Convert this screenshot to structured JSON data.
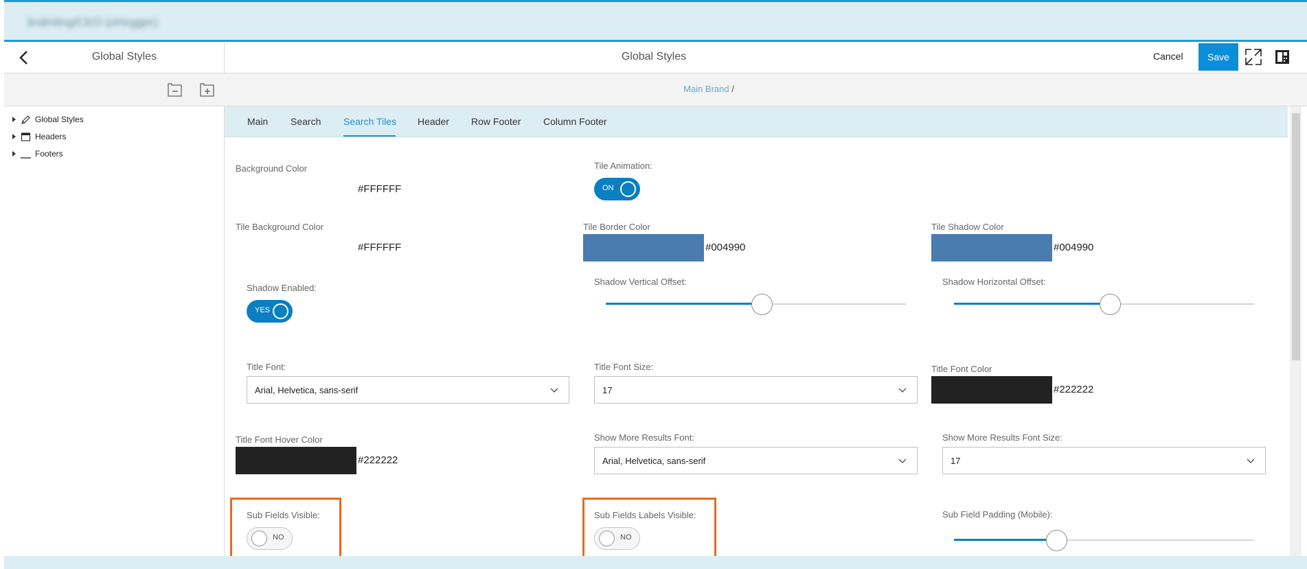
{
  "banner": {
    "title": "lindmling/CEO (oHogger)"
  },
  "left_panel": {
    "title": "Global Styles",
    "tree": [
      {
        "label": "Global Styles",
        "icon": "pencil-icon"
      },
      {
        "label": "Headers",
        "icon": "window-icon"
      },
      {
        "label": "Footers",
        "icon": "underline-icon"
      }
    ]
  },
  "header": {
    "title": "Global Styles",
    "cancel_label": "Cancel",
    "save_label": "Save"
  },
  "breadcrumb": {
    "link": "Main Brand",
    "separator": "/"
  },
  "tabs": [
    {
      "label": "Main",
      "active": false
    },
    {
      "label": "Search",
      "active": false
    },
    {
      "label": "Search Tiles",
      "active": true
    },
    {
      "label": "Header",
      "active": false
    },
    {
      "label": "Row Footer",
      "active": false
    },
    {
      "label": "Column Footer",
      "active": false
    }
  ],
  "form": {
    "background_color": {
      "label": "Background Color",
      "value": "#FFFFFF"
    },
    "tile_animation": {
      "label": "Tile Animation:",
      "state_text": "ON",
      "on": true
    },
    "tile_background_color": {
      "label": "Tile Background Color",
      "value": "#FFFFFF"
    },
    "tile_border_color": {
      "label": "Tile Border Color",
      "value": "#004990",
      "swatch": "#4a7cb0"
    },
    "tile_shadow_color": {
      "label": "Tile Shadow Color",
      "value": "#004990",
      "swatch": "#4a7cb0"
    },
    "shadow_enabled": {
      "label": "Shadow Enabled:",
      "state_text": "YES",
      "on": true
    },
    "shadow_vertical_offset": {
      "label": "Shadow Vertical Offset:",
      "fraction": 0.52
    },
    "shadow_horizontal_offset": {
      "label": "Shadow Horizontal Offset:",
      "fraction": 0.52
    },
    "title_font": {
      "label": "Title Font:",
      "value": "Arial, Helvetica, sans-serif"
    },
    "title_font_size": {
      "label": "Title Font Size:",
      "value": "17"
    },
    "title_font_color": {
      "label": "Title Font Color",
      "value": "#222222",
      "swatch": "#222222"
    },
    "title_font_hover_color": {
      "label": "Title Font Hover Color",
      "value": "#222222",
      "swatch": "#222222"
    },
    "show_more_results_font": {
      "label": "Show More Results Font:",
      "value": "Arial, Helvetica, sans-serif"
    },
    "show_more_results_font_size": {
      "label": "Show More Results Font Size:",
      "value": "17"
    },
    "sub_fields_visible": {
      "label": "Sub Fields Visible:",
      "state_text": "NO",
      "on": false
    },
    "sub_fields_labels_visible": {
      "label": "Sub Fields Labels Visible:",
      "state_text": "NO",
      "on": false
    },
    "sub_field_padding_mobile": {
      "label": "Sub Field Padding (Mobile):",
      "fraction": 0.34
    }
  },
  "colors": {
    "accent": "#0a7fc2",
    "save_button": "#0a8ed9",
    "highlight": "#e8691f",
    "banner": "#dceef4"
  }
}
